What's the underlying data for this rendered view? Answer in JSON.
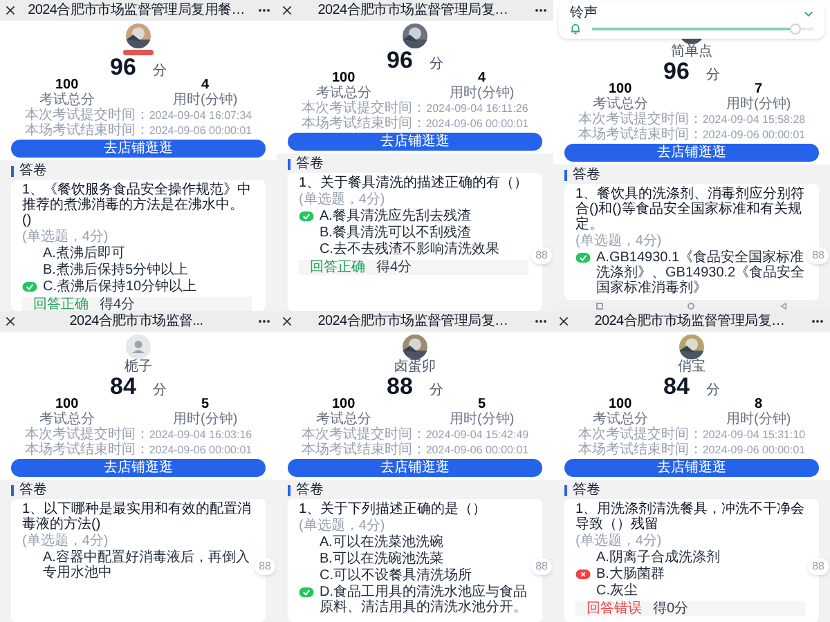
{
  "panels": [
    {
      "title": "2024合肥市市场监督管理局复用餐…",
      "avatar_photo": true,
      "name_redacted": true,
      "score": "96",
      "score_unit": "分",
      "total": "100",
      "total_label": "考试总分",
      "duration": "4",
      "duration_label": "用时(分钟)",
      "submit_label": "本次考试提交时间：",
      "submit_time": "2024-09-04 16:07:34",
      "end_label": "本场考试结束时间：",
      "end_time": "2024-09-06 00:00:01",
      "button": "去店铺逛逛",
      "section": "答卷",
      "question": "1、《餐饮服务食品安全操作规范》中推荐的煮沸消毒的方法是在沸水中。()",
      "meta": "(单选题，4分)",
      "options": [
        {
          "text": "A.煮沸后即可",
          "selected": false
        },
        {
          "text": "B.煮沸后保持5分钟以上",
          "selected": false
        },
        {
          "text": "C.煮沸后保持10分钟以上",
          "selected": true,
          "correct": true
        }
      ],
      "result": {
        "correct": true,
        "label": "回答正确",
        "points": "得4分"
      }
    },
    {
      "title": "2024合肥市市场监督管理局复…",
      "avatar_photo": true,
      "score": "96",
      "score_unit": "分",
      "total": "100",
      "total_label": "考试总分",
      "duration": "4",
      "duration_label": "用时(分钟)",
      "submit_label": "本次考试提交时间：",
      "submit_time": "2024-09-04 16:11:26",
      "end_label": "本场考试结束时间：",
      "end_time": "2024-09-06 00:00:01",
      "button": "去店铺逛逛",
      "section": "答卷",
      "question": "1、关于餐具清洗的描述正确的有（）",
      "meta": "(单选题，4分)",
      "options": [
        {
          "text": "A.餐具清洗应先刮去残渣",
          "selected": true,
          "correct": true
        },
        {
          "text": "B.餐具清洗可以不刮残渣",
          "selected": false
        },
        {
          "text": "C.去不去残渣不影响清洗效果",
          "selected": false
        }
      ],
      "result": {
        "correct": true,
        "label": "回答正确",
        "points": "得4分"
      },
      "float_badge": "88"
    },
    {
      "overlay": {
        "label": "铃声",
        "level": 0.92
      },
      "avatar_photo": true,
      "name": "简单点",
      "score": "96",
      "score_unit": "分",
      "total": "100",
      "total_label": "考试总分",
      "duration": "7",
      "duration_label": "用时(分钟)",
      "submit_label": "本次考试提交时间：",
      "submit_time": "2024-09-04 15:58:28",
      "end_label": "本场考试结束时间：",
      "end_time": "2024-09-06 00:00:01",
      "button": "去店铺逛逛",
      "section": "答卷",
      "question": "1、餐饮具的洗涤剂、消毒剂应分别符合()和()等食品安全国家标准和有关规定。",
      "meta": "(单选题，4分)",
      "options": [
        {
          "text": "A.GB14930.1《食品安全国家标准洗涤剂》、GB14930.2《食品安全国家标准消毒剂》",
          "selected": true,
          "correct": true
        }
      ],
      "float_badge": "88",
      "nav_bar": true
    },
    {
      "title": "2024合肥市市场监督...",
      "avatar_photo": false,
      "name": "栀子",
      "score": "84",
      "score_unit": "分",
      "total": "100",
      "total_label": "考试总分",
      "duration": "5",
      "duration_label": "用时(分钟)",
      "submit_label": "本次考试提交时间：",
      "submit_time": "2024-09-04 16:03:16",
      "end_label": "本场考试结束时间：",
      "end_time": "2024-09-06 00:00:01",
      "button": "去店铺逛逛",
      "section": "答卷",
      "question": "1、以下哪种是最实用和有效的配置消毒液的方法()",
      "meta": "(单选题，4分)",
      "options": [
        {
          "text": "A.容器中配置好消毒液后，再倒入专用水池中",
          "selected": false
        }
      ],
      "float_badge": "88"
    },
    {
      "title": "2024合肥市市场监督管理局复…",
      "avatar_photo": true,
      "name": "卤蛋卯",
      "score": "88",
      "score_unit": "分",
      "total": "100",
      "total_label": "考试总分",
      "duration": "5",
      "duration_label": "用时(分钟)",
      "submit_label": "本次考试提交时间：",
      "submit_time": "2024-09-04 15:42:49",
      "end_label": "本场考试结束时间：",
      "end_time": "2024-09-06 00:00:01",
      "button": "去店铺逛逛",
      "section": "答卷",
      "question": "1、关于下列描述正确的是（）",
      "meta": "(单选题，4分)",
      "options": [
        {
          "text": "A.可以在洗菜池洗碗",
          "selected": false
        },
        {
          "text": "B.可以在洗碗池洗菜",
          "selected": false
        },
        {
          "text": "C.可以不设餐具清洗场所",
          "selected": false
        },
        {
          "text": "D.食品工用具的清洗水池应与食品原料、清洁用具的清洗水池分开。",
          "selected": true,
          "correct": true
        }
      ],
      "float_badge": "88"
    },
    {
      "title": "2024合肥市市场监督管理局复…",
      "avatar_photo": true,
      "name": "俏宝",
      "score": "84",
      "score_unit": "分",
      "total": "100",
      "total_label": "考试总分",
      "duration": "8",
      "duration_label": "用时(分钟)",
      "submit_label": "本次考试提交时间：",
      "submit_time": "2024-09-04 15:31:10",
      "end_label": "本场考试结束时间：",
      "end_time": "2024-09-06 00:00:01",
      "button": "去店铺逛逛",
      "section": "答卷",
      "question": "1、用洗涤剂清洗餐具，冲洗不干净会导致（）残留",
      "meta": "(单选题，4分)",
      "options": [
        {
          "text": "A.阴离子合成洗涤剂",
          "selected": false
        },
        {
          "text": "B.大肠菌群",
          "selected": true,
          "correct": false
        },
        {
          "text": "C.灰尘",
          "selected": false
        }
      ],
      "result": {
        "correct": false,
        "label": "回答错误",
        "points": "得0分"
      },
      "float_badge": "88"
    }
  ]
}
